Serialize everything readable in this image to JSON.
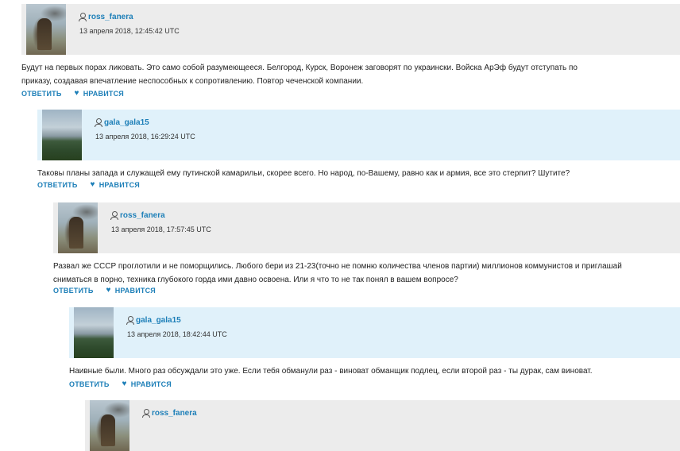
{
  "comments": [
    {
      "username": "ross_fanera",
      "date": "13 апреля 2018, 12:45:42 UTC",
      "text": "Будут на первых порах ликовать. Это само собой разумеющееся. Белгород, Курск, Воронеж заговорят по украински. Войска АрЭф будут отступать по приказу, создавая впечатление неспособных к сопротивлению. Повтор чеченской компании.",
      "reply_label": "ОТВЕТИТЬ",
      "like_label": "НРАВИТСЯ"
    },
    {
      "username": "gala_gala15",
      "date": "13 апреля 2018, 16:29:24 UTC",
      "text": "Таковы планы запада и служащей ему путинской камарильи, скорее всего. Но народ, по-Вашему, равно как и армия, все это стерпит? Шутите?",
      "reply_label": "ОТВЕТИТЬ",
      "like_label": "НРАВИТСЯ"
    },
    {
      "username": "ross_fanera",
      "date": "13 апреля 2018, 17:57:45 UTC",
      "text": "Развал же СССР проглотили и не поморщились. Любого бери из 21-23(точно не помню количества членов партии) миллионов коммунистов и приглашай сниматься в порно, техника глубокого горда ими давно освоена. Или я что то не так понял в вашем вопросе?",
      "reply_label": "ОТВЕТИТЬ",
      "like_label": "НРАВИТСЯ"
    },
    {
      "username": "gala_gala15",
      "date": "13 апреля 2018, 18:42:44 UTC",
      "text": "Наивные были. Много раз обсуждали это уже. Если тебя обманули раз - виноват обманщик подлец, если второй раз - ты дурак, сам виноват.",
      "reply_label": "ОТВЕТИТЬ",
      "like_label": "НРАВИТСЯ"
    },
    {
      "username": "ross_fanera"
    }
  ]
}
